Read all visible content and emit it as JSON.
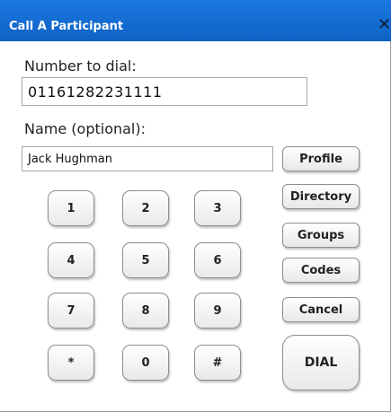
{
  "dialog": {
    "title": "Call A Participant",
    "close_glyph": "✕",
    "number_label": "Number to dial:",
    "number_value": "01161282231111",
    "name_label": "Name (optional):",
    "name_value": "Jack Hughman"
  },
  "keypad": {
    "keys": [
      "1",
      "2",
      "3",
      "4",
      "5",
      "6",
      "7",
      "8",
      "9",
      "*",
      "0",
      "#"
    ]
  },
  "buttons": {
    "profile": "Profile",
    "directory": "Directory",
    "groups": "Groups",
    "codes": "Codes",
    "cancel": "Cancel",
    "dial": "DIAL"
  },
  "colors": {
    "titlebar": "#1670d6",
    "title_text": "#ffffff"
  }
}
